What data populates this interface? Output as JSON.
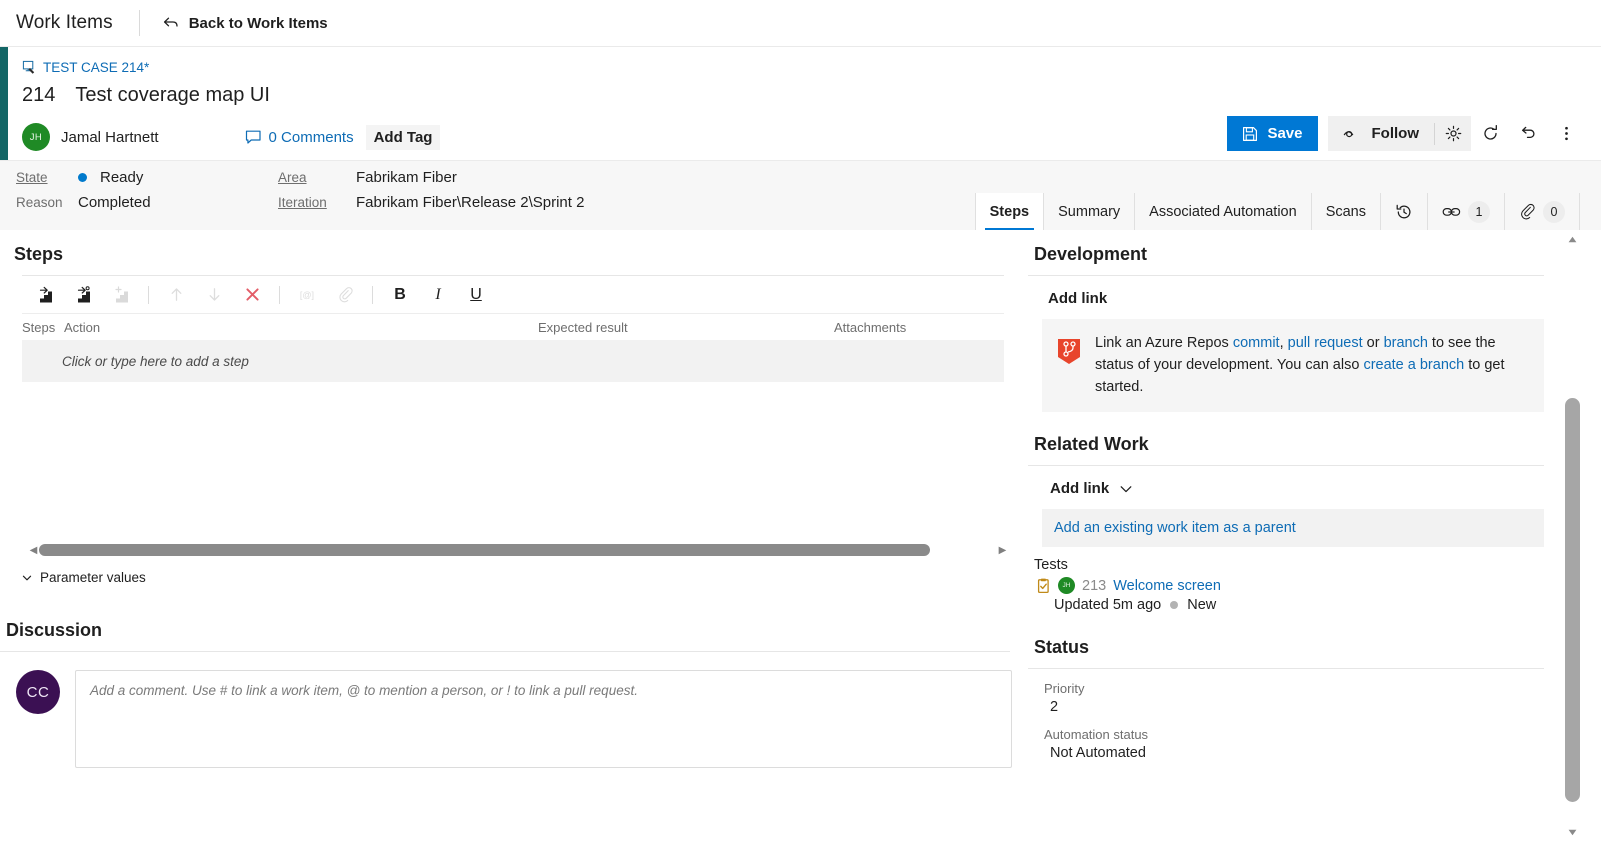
{
  "hub": {
    "title": "Work Items",
    "back_label": "Back to Work Items",
    "back_icon": "back-arrow-icon"
  },
  "workitem": {
    "type_label": "TEST CASE 214*",
    "type_icon": "test-case-icon",
    "id": "214",
    "title": "Test coverage map UI",
    "assignee": {
      "name": "Jamal Hartnett",
      "initials": "JH",
      "avatar_color": "#1f8a25"
    },
    "comments_label": "0 Comments",
    "comments_icon": "comment-bubble-icon",
    "add_tag_label": "Add Tag",
    "accent_color": "#136666"
  },
  "toolbar": {
    "save_label": "Save",
    "save_icon": "save-floppy-icon",
    "save_color": "#0078d4",
    "follow_label": "Follow",
    "follow_icon": "eye-icon",
    "gear_icon": "gear-icon",
    "refresh_icon": "refresh-icon",
    "revert_icon": "undo-revert-icon",
    "more_icon": "more-actions-icon"
  },
  "fields": {
    "state_label": "State",
    "state_value": "Ready",
    "state_dot_color": "#007acc",
    "reason_label": "Reason",
    "reason_value": "Completed",
    "area_label": "Area",
    "area_value": "Fabrikam Fiber",
    "iteration_label": "Iteration",
    "iteration_value": "Fabrikam Fiber\\Release 2\\Sprint 2"
  },
  "tabs": [
    {
      "label": "Steps",
      "active": true
    },
    {
      "label": "Summary",
      "active": false
    },
    {
      "label": "Associated Automation",
      "active": false
    },
    {
      "label": "Scans",
      "active": false
    },
    {
      "label": "",
      "icon": "history-icon",
      "active": false
    },
    {
      "label": "",
      "icon": "link-icon",
      "count": "1",
      "active": false
    },
    {
      "label": "",
      "icon": "attachment-paperclip-icon",
      "count": "0",
      "active": false
    }
  ],
  "steps": {
    "heading": "Steps",
    "toolbar_icons": [
      {
        "name": "insert-step-icon",
        "disabled": false
      },
      {
        "name": "insert-shared-step-icon",
        "disabled": false
      },
      {
        "name": "insert-step-after-icon",
        "disabled": true
      },
      {
        "name": "move-up-icon",
        "disabled": true
      },
      {
        "name": "move-down-icon",
        "disabled": true
      },
      {
        "name": "delete-step-icon",
        "disabled": false
      },
      {
        "name": "insert-parameter-icon",
        "disabled": true
      },
      {
        "name": "attach-file-icon",
        "disabled": true
      }
    ],
    "bold_label": "B",
    "italic_label": "I",
    "underline_label": "U",
    "columns": {
      "steps": "Steps",
      "action": "Action",
      "expected": "Expected result",
      "attachments": "Attachments"
    },
    "add_step_placeholder": "Click or type here to add a step",
    "parameter_values_label": "Parameter values"
  },
  "discussion": {
    "heading": "Discussion",
    "user_initials": "CC",
    "avatar_color": "#3b1053",
    "comment_placeholder": "Add a comment. Use # to link a work item, @ to mention a person, or ! to link a pull request."
  },
  "development": {
    "heading": "Development",
    "add_link_label": "Add link",
    "icon": "azure-repos-branch-icon",
    "text_part1": "Link an Azure Repos ",
    "link_commit": "commit",
    "text_comma": ", ",
    "link_pull_request": "pull request",
    "text_or": " or ",
    "link_branch": "branch",
    "text_part2": " to see the status of your development. You can also ",
    "link_create_branch": "create a branch",
    "text_part3": " to get started."
  },
  "related_work": {
    "heading": "Related Work",
    "add_link_label": "Add link",
    "chevron_icon": "chevron-down-icon",
    "add_parent_label": "Add an existing work item as a parent",
    "group_label": "Tests",
    "item": {
      "icon": "test-case-icon",
      "initials": "JH",
      "id": "213",
      "name": "Welcome screen",
      "updated": "Updated 5m ago",
      "state": "New",
      "state_dot_color": "#b3b3b3"
    }
  },
  "status": {
    "heading": "Status",
    "priority_label": "Priority",
    "priority_value": "2",
    "automation_label": "Automation status",
    "automation_value": "Not Automated"
  },
  "scrollbars": {
    "h_left_arrow": "◀",
    "h_right_arrow": "▶",
    "v_up_arrow": "▲",
    "v_down_arrow": "▼"
  }
}
